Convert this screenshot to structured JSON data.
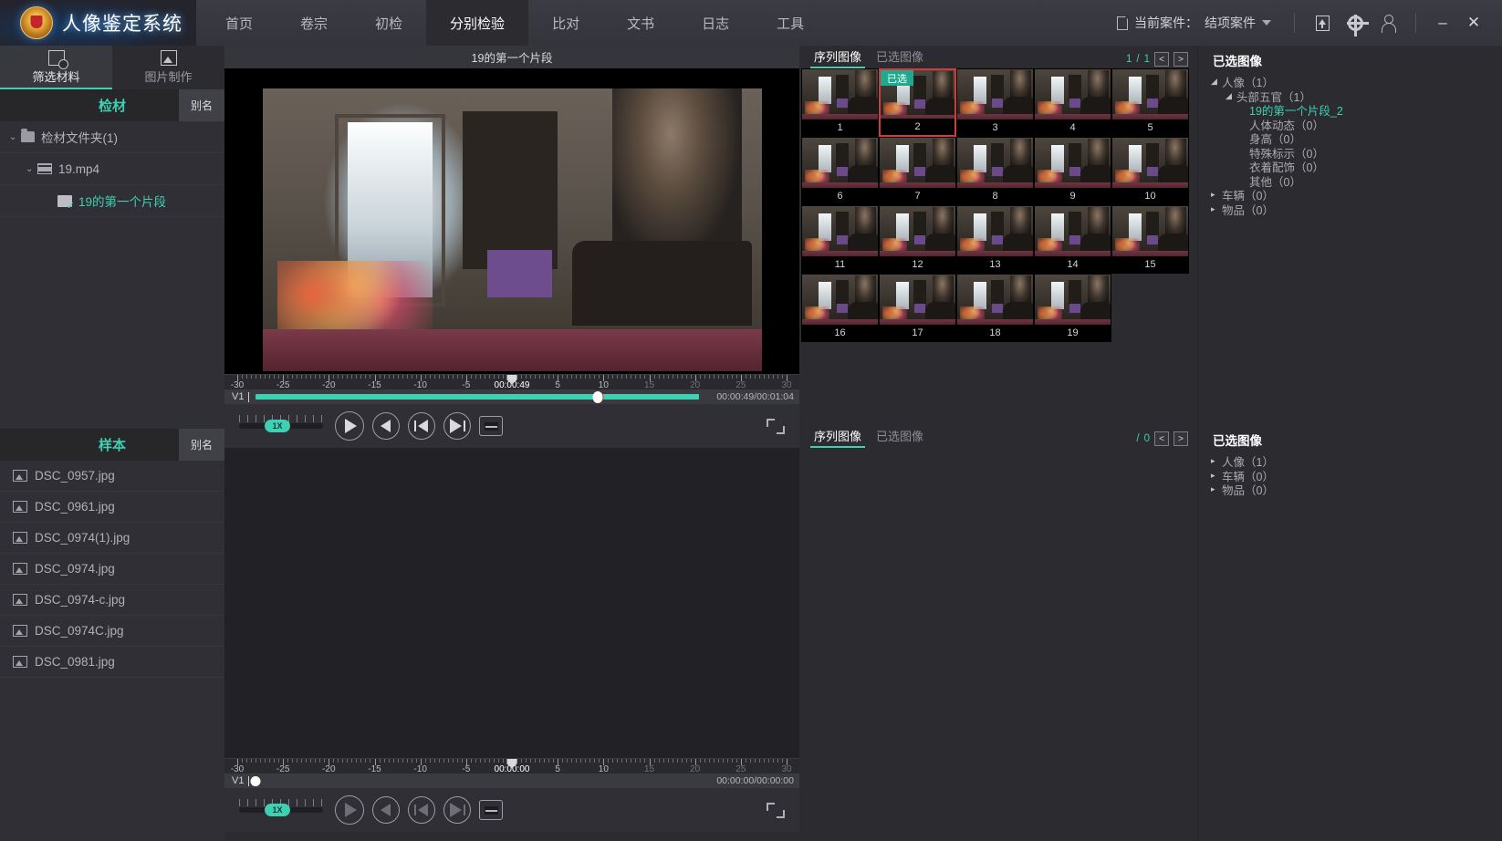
{
  "header": {
    "brand_title": "人像鉴定系统",
    "nav": [
      {
        "label": "首页",
        "active": false
      },
      {
        "label": "卷宗",
        "active": false
      },
      {
        "label": "初检",
        "active": false
      },
      {
        "label": "分别检验",
        "active": true
      },
      {
        "label": "比对",
        "active": false
      },
      {
        "label": "文书",
        "active": false
      },
      {
        "label": "日志",
        "active": false
      },
      {
        "label": "工具",
        "active": false
      }
    ],
    "case_label": "当前案件：",
    "case_value": "结项案件",
    "minimize": "–",
    "close": "✕"
  },
  "left": {
    "tabs": [
      {
        "label": "筛选材料",
        "active": true
      },
      {
        "label": "图片制作",
        "active": false
      }
    ],
    "evidence": {
      "title": "检材",
      "alias_label": "别名",
      "items": [
        {
          "label": "检材文件夹(1)",
          "level": 1,
          "chevron": "⌄",
          "icon": "folder-icon"
        },
        {
          "label": "19.mp4",
          "level": 2,
          "chevron": "⌄",
          "icon": "film-icon"
        },
        {
          "label": "19的第一个片段",
          "level": 3,
          "chevron": "",
          "icon": "clip-icon"
        }
      ]
    },
    "sample": {
      "title": "样本",
      "alias_label": "别名",
      "items": [
        {
          "label": "DSC_0957.jpg"
        },
        {
          "label": "DSC_0961.jpg"
        },
        {
          "label": "DSC_0974(1).jpg"
        },
        {
          "label": "DSC_0974.jpg"
        },
        {
          "label": "DSC_0974-c.jpg"
        },
        {
          "label": "DSC_0974C.jpg"
        },
        {
          "label": "DSC_0981.jpg"
        }
      ]
    }
  },
  "center": {
    "video_title": "19的第一个片段",
    "top_timeline": {
      "ticks": [
        "-30",
        "-25",
        "-20",
        "-15",
        "-10",
        "-5",
        "00:00:49",
        "5",
        "10",
        "15",
        "20",
        "25",
        "30"
      ],
      "current_time_label": "00:00:49",
      "track_name": "V1",
      "timecode": "00:00:49/00:01:04",
      "speed_label": "1X"
    },
    "bottom_timeline": {
      "ticks": [
        "-30",
        "-25",
        "-20",
        "-15",
        "-10",
        "-5",
        "00:00:00",
        "5",
        "10",
        "15",
        "20",
        "25",
        "30"
      ],
      "current_time_label": "00:00:00",
      "track_name": "V1",
      "timecode": "00:00:00/00:00:00",
      "speed_label": "1X"
    }
  },
  "thumbs_top": {
    "tabs": [
      {
        "label": "序列图像",
        "active": true
      },
      {
        "label": "已选图像",
        "active": false
      }
    ],
    "page_current": "1",
    "page_sep": "/",
    "page_total": "1",
    "prev": "<",
    "next": ">",
    "selected_badge": "已选",
    "selected_index": 2,
    "items": [
      "1",
      "2",
      "3",
      "4",
      "5",
      "6",
      "7",
      "8",
      "9",
      "10",
      "11",
      "12",
      "13",
      "14",
      "15",
      "16",
      "17",
      "18",
      "19"
    ]
  },
  "thumbs_bottom": {
    "tabs": [
      {
        "label": "序列图像",
        "active": true
      },
      {
        "label": "已选图像",
        "active": false
      }
    ],
    "page_current": "",
    "page_sep": "/",
    "page_total": "0",
    "prev": "<",
    "next": ">",
    "items": []
  },
  "right_top": {
    "title": "已选图像",
    "rows": [
      {
        "label": "人像（1）",
        "indent": 14,
        "arrow": "◢",
        "green": false
      },
      {
        "label": "头部五官（1）",
        "indent": 30,
        "arrow": "◢",
        "green": false
      },
      {
        "label": "19的第一个片段_2",
        "indent": 44,
        "arrow": "",
        "green": true
      },
      {
        "label": "人体动态（0）",
        "indent": 44,
        "arrow": "",
        "green": false
      },
      {
        "label": "身高（0）",
        "indent": 44,
        "arrow": "",
        "green": false
      },
      {
        "label": "特殊标示（0）",
        "indent": 44,
        "arrow": "",
        "green": false
      },
      {
        "label": "衣着配饰（0）",
        "indent": 44,
        "arrow": "",
        "green": false
      },
      {
        "label": "其他（0）",
        "indent": 44,
        "arrow": "",
        "green": false
      },
      {
        "label": "车辆（0）",
        "indent": 14,
        "arrow": "▸",
        "green": false
      },
      {
        "label": "物品（0）",
        "indent": 14,
        "arrow": "▸",
        "green": false
      }
    ]
  },
  "right_bottom": {
    "title": "已选图像",
    "rows": [
      {
        "label": "人像（1）",
        "indent": 14,
        "arrow": "▸",
        "green": false
      },
      {
        "label": "车辆（0）",
        "indent": 14,
        "arrow": "▸",
        "green": false
      },
      {
        "label": "物品（0）",
        "indent": 14,
        "arrow": "▸",
        "green": false
      }
    ]
  },
  "colors": {
    "accent": "#3fcfb2",
    "selection": "#d23b3b",
    "panel": "#2b2b30"
  }
}
